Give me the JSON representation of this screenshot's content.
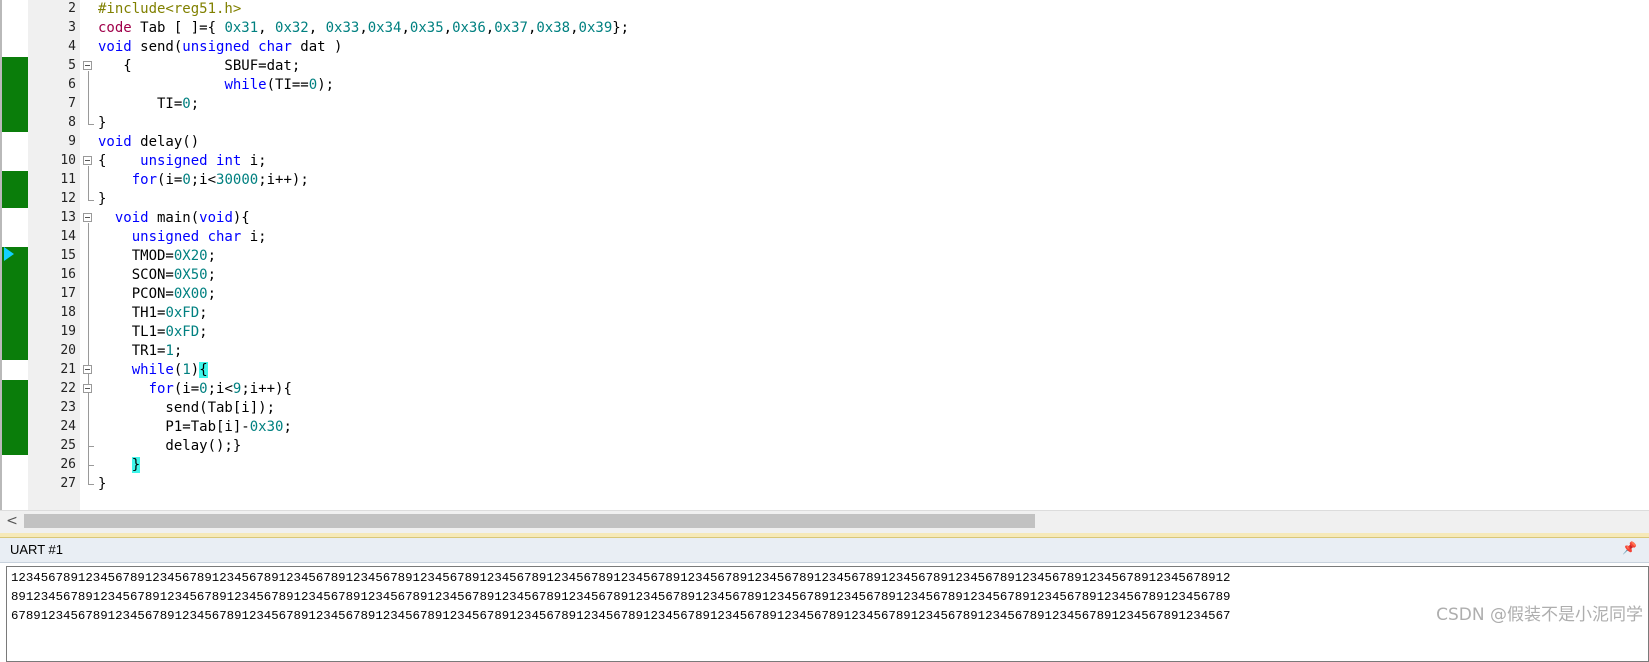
{
  "editor": {
    "lines": [
      {
        "n": "2",
        "segs": [
          [
            "pp",
            "#include<reg51.h>"
          ]
        ]
      },
      {
        "n": "3",
        "segs": [
          [
            "code-kw",
            "code"
          ],
          [
            "",
            " Tab [ ]={ "
          ],
          [
            "num",
            "0x31"
          ],
          [
            "",
            ", "
          ],
          [
            "num",
            "0x32"
          ],
          [
            "",
            ", "
          ],
          [
            "num",
            "0x33"
          ],
          [
            "",
            ","
          ],
          [
            "num",
            "0x34"
          ],
          [
            "",
            ","
          ],
          [
            "num",
            "0x35"
          ],
          [
            "",
            ","
          ],
          [
            "num",
            "0x36"
          ],
          [
            "",
            ","
          ],
          [
            "num",
            "0x37"
          ],
          [
            "",
            ","
          ],
          [
            "num",
            "0x38"
          ],
          [
            "",
            ","
          ],
          [
            "num",
            "0x39"
          ],
          [
            "",
            "};"
          ]
        ]
      },
      {
        "n": "4",
        "segs": [
          [
            "kw",
            "void"
          ],
          [
            "",
            " send("
          ],
          [
            "kw",
            "unsigned char"
          ],
          [
            "",
            " dat )"
          ]
        ]
      },
      {
        "n": "5",
        "segs": [
          [
            "",
            "   {           SBUF=dat;"
          ]
        ]
      },
      {
        "n": "6",
        "segs": [
          [
            "",
            "               "
          ],
          [
            "kw",
            "while"
          ],
          [
            "",
            "(TI=="
          ],
          [
            "num",
            "0"
          ],
          [
            "",
            ");"
          ]
        ]
      },
      {
        "n": "7",
        "segs": [
          [
            "",
            "       TI="
          ],
          [
            "num",
            "0"
          ],
          [
            "",
            ";"
          ]
        ]
      },
      {
        "n": "8",
        "segs": [
          [
            "",
            "}"
          ]
        ]
      },
      {
        "n": "9",
        "segs": [
          [
            "kw",
            "void"
          ],
          [
            "",
            " delay()"
          ]
        ]
      },
      {
        "n": "10",
        "segs": [
          [
            "",
            "{    "
          ],
          [
            "kw",
            "unsigned int"
          ],
          [
            "",
            " i;"
          ]
        ]
      },
      {
        "n": "11",
        "segs": [
          [
            "",
            "    "
          ],
          [
            "kw",
            "for"
          ],
          [
            "",
            "(i="
          ],
          [
            "num",
            "0"
          ],
          [
            "",
            ";i<"
          ],
          [
            "num",
            "30000"
          ],
          [
            "",
            ";i++);"
          ]
        ]
      },
      {
        "n": "12",
        "segs": [
          [
            "",
            "}"
          ]
        ]
      },
      {
        "n": "13",
        "segs": [
          [
            "",
            "  "
          ],
          [
            "kw",
            "void"
          ],
          [
            "",
            " main("
          ],
          [
            "kw",
            "void"
          ],
          [
            "",
            "){"
          ]
        ]
      },
      {
        "n": "14",
        "segs": [
          [
            "",
            "    "
          ],
          [
            "kw",
            "unsigned char"
          ],
          [
            "",
            " i;"
          ]
        ]
      },
      {
        "n": "15",
        "segs": [
          [
            "",
            "    TMOD="
          ],
          [
            "num",
            "0X20"
          ],
          [
            "",
            ";"
          ]
        ]
      },
      {
        "n": "16",
        "segs": [
          [
            "",
            "    SCON="
          ],
          [
            "num",
            "0X50"
          ],
          [
            "",
            ";"
          ]
        ]
      },
      {
        "n": "17",
        "segs": [
          [
            "",
            "    PCON="
          ],
          [
            "num",
            "0X00"
          ],
          [
            "",
            ";"
          ]
        ]
      },
      {
        "n": "18",
        "segs": [
          [
            "",
            "    TH1="
          ],
          [
            "num",
            "0xFD"
          ],
          [
            "",
            ";"
          ]
        ]
      },
      {
        "n": "19",
        "segs": [
          [
            "",
            "    TL1="
          ],
          [
            "num",
            "0xFD"
          ],
          [
            "",
            ";"
          ]
        ]
      },
      {
        "n": "20",
        "segs": [
          [
            "",
            "    TR1="
          ],
          [
            "num",
            "1"
          ],
          [
            "",
            ";"
          ]
        ]
      },
      {
        "n": "21",
        "segs": [
          [
            "",
            "    "
          ],
          [
            "kw",
            "while"
          ],
          [
            "",
            "("
          ],
          [
            "num",
            "1"
          ],
          [
            "",
            ")"
          ],
          [
            "hl",
            "{"
          ]
        ]
      },
      {
        "n": "22",
        "segs": [
          [
            "",
            "      "
          ],
          [
            "kw",
            "for"
          ],
          [
            "",
            "(i="
          ],
          [
            "num",
            "0"
          ],
          [
            "",
            ";i<"
          ],
          [
            "num",
            "9"
          ],
          [
            "",
            ";i++){"
          ]
        ]
      },
      {
        "n": "23",
        "segs": [
          [
            "",
            "        send(Tab[i]);"
          ]
        ]
      },
      {
        "n": "24",
        "segs": [
          [
            "",
            "        P1=Tab[i]-"
          ],
          [
            "num",
            "0x30"
          ],
          [
            "",
            ";"
          ]
        ]
      },
      {
        "n": "25",
        "segs": [
          [
            "",
            "        delay();}"
          ]
        ]
      },
      {
        "n": "26",
        "segs": [
          [
            "",
            "    "
          ],
          [
            "hl",
            "}"
          ]
        ]
      },
      {
        "n": "27",
        "segs": [
          [
            "",
            "}"
          ]
        ]
      }
    ],
    "scroll_left_glyph": "<",
    "horizontal_scroll_fraction": 0.62
  },
  "uart": {
    "title": "UART #1",
    "pin_glyph": "📌",
    "output_lines": [
      "12345678912345678912345678912345678912345678912345678912345678912345678912345678912345678912345678912345678912345678912345678912345678912345678912345678912345678912",
      "89123456789123456789123456789123456789123456789123456789123456789123456789123456789123456789123456789123456789123456789123456789123456789123456789123456789123456789",
      "67891234567891234567891234567891234567891234567891234567891234567891234567891234567891234567891234567891234567891234567891234567891234567891234567891234567891234567"
    ]
  },
  "watermark": "CSDN @假装不是小泥同学",
  "colors": {
    "keyword": "#0000ff",
    "number": "#008080",
    "preprocessor": "#808000",
    "code_keyword": "#a0004a",
    "coverage": "#0a7d0a",
    "brace_highlight": "#3ff5ea"
  }
}
